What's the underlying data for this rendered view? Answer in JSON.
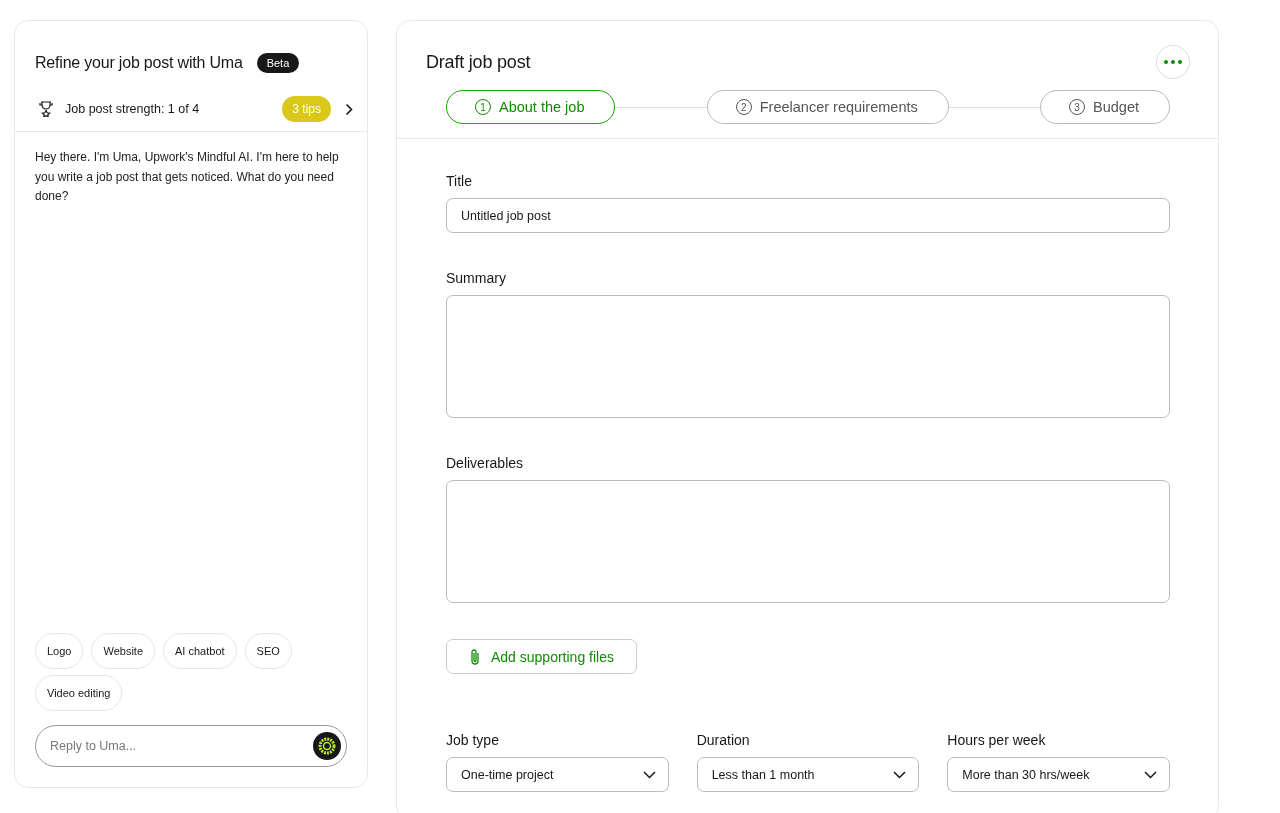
{
  "assistant": {
    "title": "Refine your job post with Uma",
    "badge": "Beta",
    "strength": {
      "label": "Job post strength: 1 of 4",
      "tips": "3 tips"
    },
    "message": "Hey there. I'm Uma, Upwork's Mindful AI. I'm here to help you write a job post that gets noticed. What do you need done?",
    "suggestions": [
      "Logo",
      "Website",
      "AI chatbot",
      "SEO",
      "Video editing"
    ],
    "reply": {
      "placeholder": "Reply to Uma..."
    }
  },
  "draft": {
    "title": "Draft job post",
    "steps": [
      {
        "number": "1",
        "label": "About the job",
        "selected": true
      },
      {
        "number": "2",
        "label": "Freelancer requirements",
        "selected": false
      },
      {
        "number": "3",
        "label": "Budget",
        "selected": false
      }
    ],
    "fields": [
      {
        "kind": "input",
        "label": "Title",
        "value": "Untitled job post"
      },
      {
        "kind": "textarea",
        "label": "Summary"
      },
      {
        "kind": "textarea",
        "label": "Deliverables"
      }
    ],
    "attach_button": "Add supporting files",
    "selects": [
      {
        "label": "Job type",
        "value": "One-time project"
      },
      {
        "label": "Duration",
        "value": "Less than 1 month"
      },
      {
        "label": "Hours per week",
        "value": "More than 30 hrs/week"
      }
    ]
  }
}
